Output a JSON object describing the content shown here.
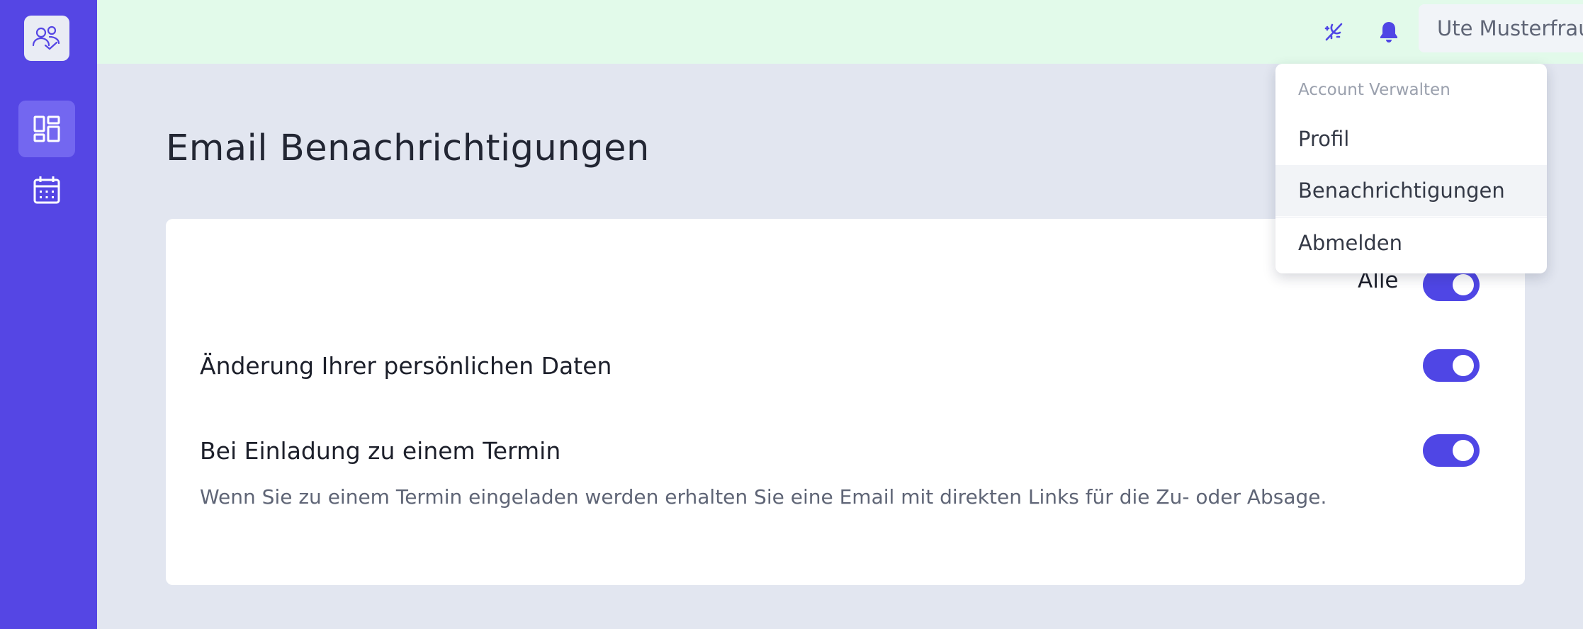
{
  "topbar": {
    "user_name": "Ute Musterfrau"
  },
  "page": {
    "title": "Email Benachrichtigungen"
  },
  "settings": {
    "all_label": "Alle",
    "rows": [
      {
        "title": "Änderung Ihrer persönlichen Daten",
        "description": ""
      },
      {
        "title": "Bei Einladung zu einem Termin",
        "description": "Wenn Sie zu einem Termin eingeladen werden erhalten Sie eine Email mit direkten Links für die Zu- oder Absage."
      }
    ]
  },
  "dropdown": {
    "heading": "Account Verwalten",
    "items": [
      {
        "label": "Profil"
      },
      {
        "label": "Benachrichtigungen"
      },
      {
        "label": "Abmelden"
      }
    ]
  },
  "colors": {
    "sidebar": "#5546e4",
    "accent": "#4f46e5",
    "topbar": "#e2faea",
    "background": "#e2e6f0"
  },
  "icons": {
    "logo": "user-group-logo-icon",
    "dashboard": "dashboard-icon",
    "calendar": "calendar-icon",
    "theme": "theme-toggle-icon",
    "bell": "bell-icon",
    "chevron": "chevron-down-icon"
  }
}
